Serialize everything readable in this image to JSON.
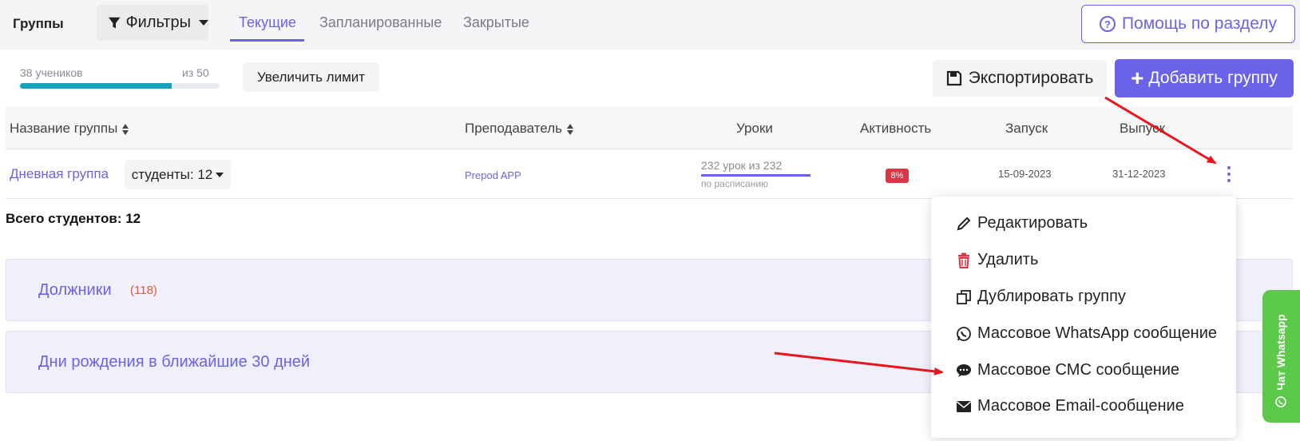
{
  "header": {
    "section_title": "Группы",
    "filters_label": "Фильтры",
    "tabs": [
      {
        "label": "Текущие",
        "active": true
      },
      {
        "label": "Запланированные",
        "active": false
      },
      {
        "label": "Закрытые",
        "active": false
      }
    ],
    "help_label": "Помощь по разделу"
  },
  "limit": {
    "students_label": "38 учеников",
    "max_label": "из 50",
    "progress": 0.76,
    "increase_label": "Увеличить лимит"
  },
  "actions": {
    "export_label": "Экспортировать",
    "add_label": "Добавить группу"
  },
  "table": {
    "columns": [
      "Название группы",
      "Преподаватель",
      "Уроки",
      "Активность",
      "Запуск",
      "Выпуск"
    ],
    "rows": [
      {
        "name": "Дневная группа",
        "students": "студенты: 12",
        "teacher": "Prepod APP",
        "lessons_text": "232 урок из 232",
        "lessons_progress": 1.0,
        "lessons_sub": "по расписанию",
        "activity": "8%",
        "start": "15-09-2023",
        "end": "31-12-2023"
      }
    ]
  },
  "total_students": "Всего студентов: 12",
  "panels": {
    "debtors_title": "Должники",
    "debtors_count": "(118)",
    "birthdays_title": "Дни рождения в ближайшие 30 дней"
  },
  "dropdown": {
    "items": [
      {
        "label": "Редактировать",
        "icon": "pencil-icon"
      },
      {
        "label": "Удалить",
        "icon": "trash-icon"
      },
      {
        "label": "Дублировать группу",
        "icon": "copy-icon"
      },
      {
        "label": "Массовое WhatsApp сообщение",
        "icon": "whatsapp-icon"
      },
      {
        "label": "Массовое СМС сообщение",
        "icon": "sms-icon"
      },
      {
        "label": "Массовое Email-сообщение",
        "icon": "envelope-icon"
      }
    ]
  },
  "whatsapp_chat": {
    "label": "Чат Whatsapp"
  },
  "colors": {
    "accent": "#6a63e8",
    "progress": "#17a2b8",
    "danger": "#dc3545",
    "whatsapp": "#5cc94b",
    "annotation_arrow": "#e8161b"
  }
}
